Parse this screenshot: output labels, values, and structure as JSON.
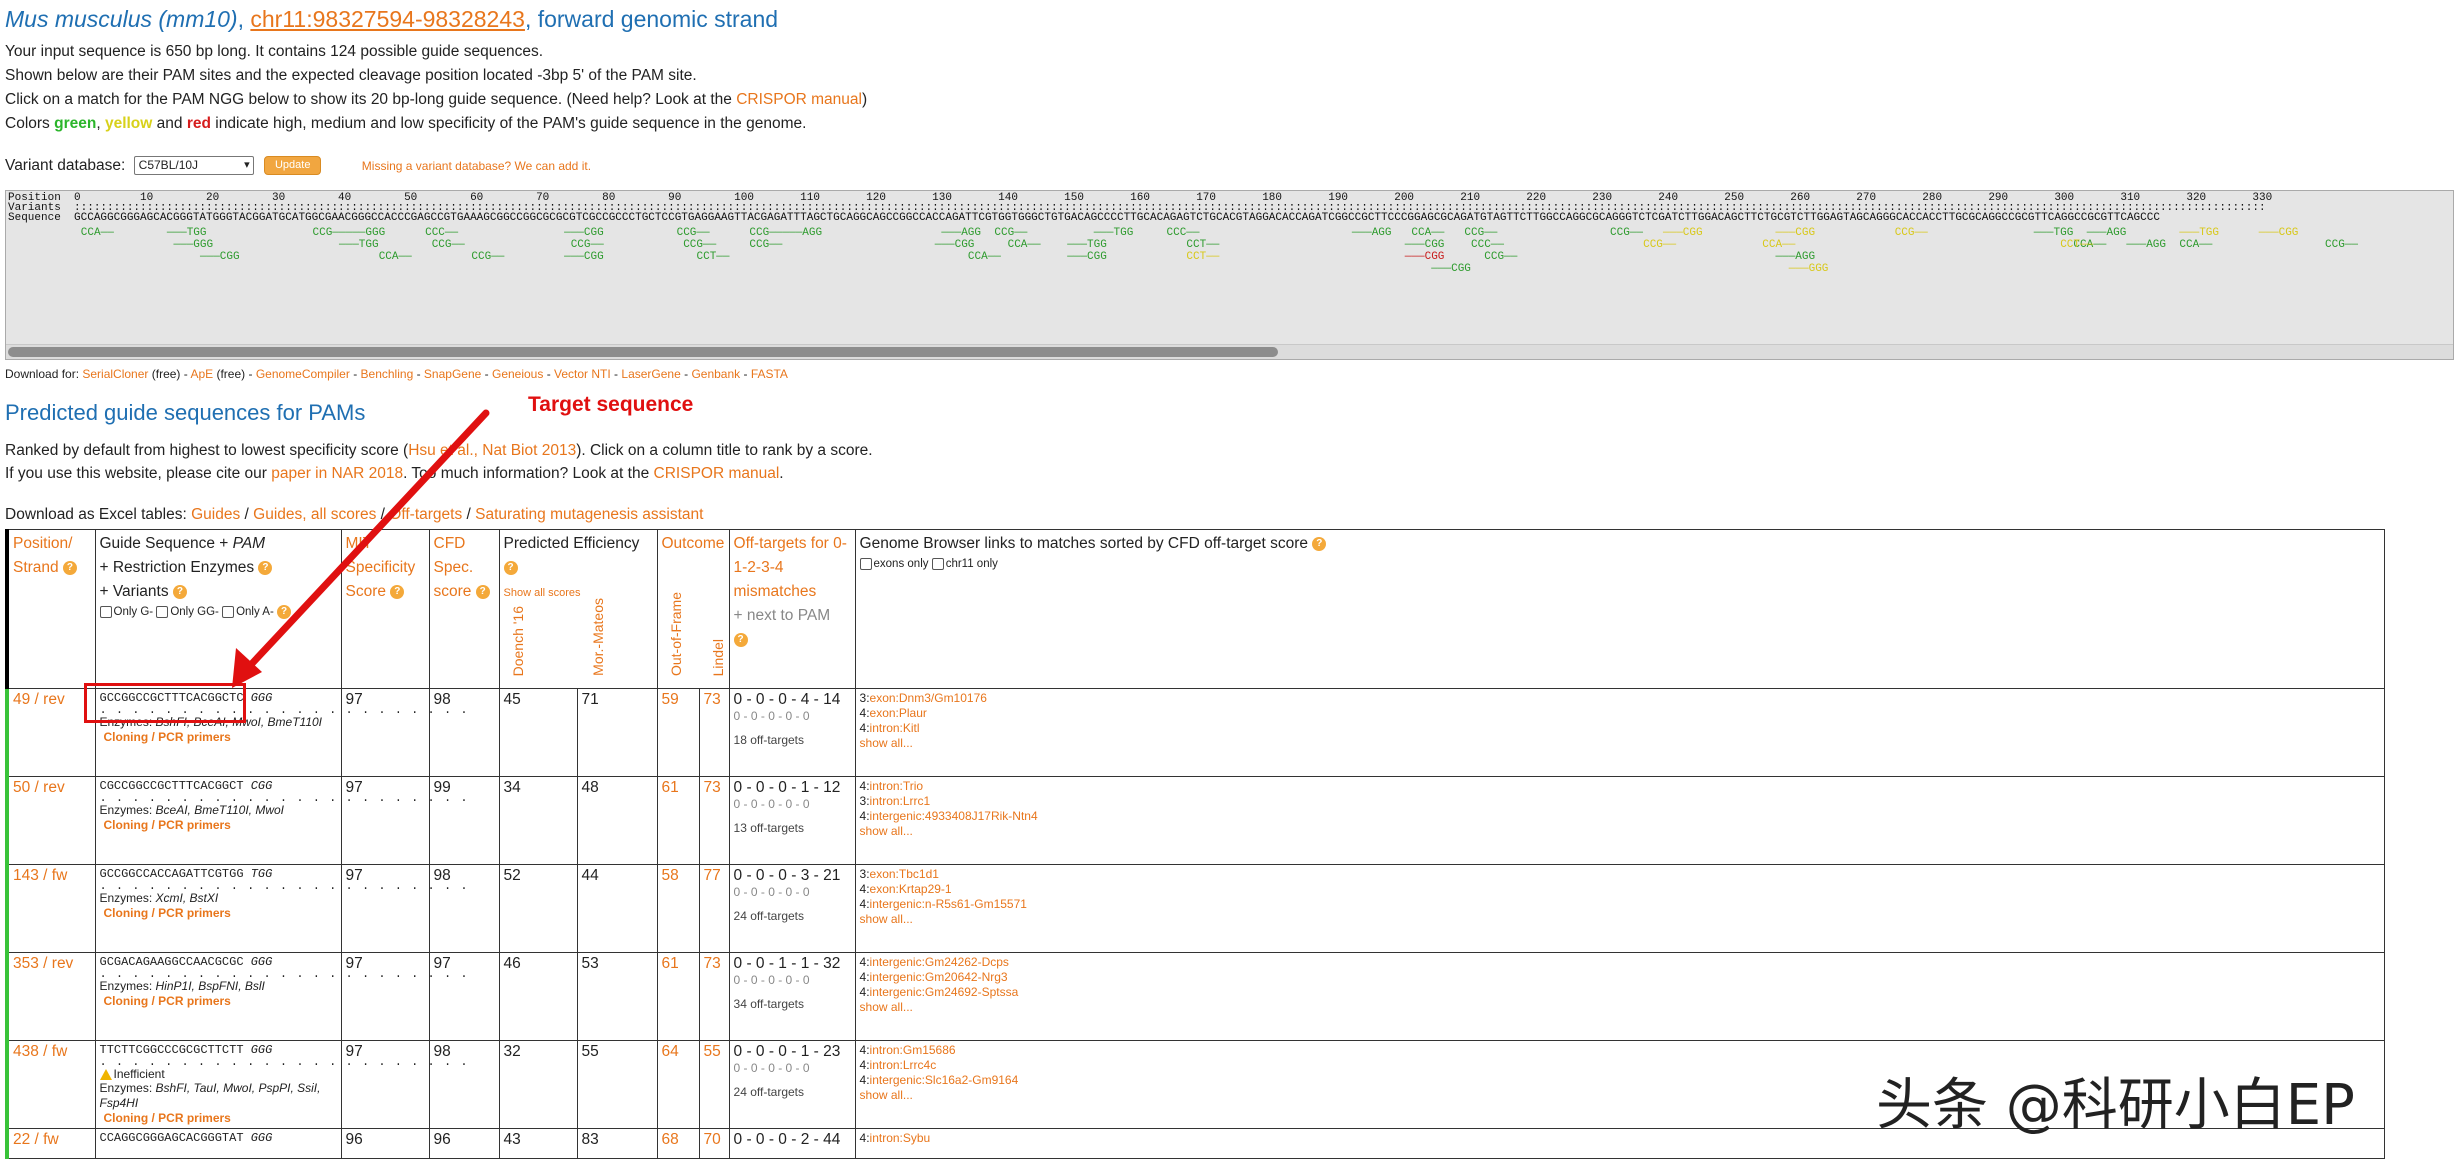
{
  "header": {
    "species": "Mus musculus (mm10)",
    "separator": ",",
    "coordinates": "chr11:98327594-98328243",
    "strand": ", forward genomic strand"
  },
  "intro": {
    "line1": "Your input sequence is 650 bp long. It contains 124 possible guide sequences.",
    "line2": "Shown below are their PAM sites and the expected cleavage position located -3bp 5' of the PAM site.",
    "line3_pre": "Click on a match for the PAM NGG below to show its 20 bp-long guide sequence. (Need help? Look at the ",
    "line3_link": "CRISPOR manual",
    "line3_post": ")",
    "line4_pre": "Colors ",
    "green": "green",
    "comma": ", ",
    "yellow": "yellow",
    "and": " and ",
    "red": "red",
    "line4_post": " indicate high, medium and low specificity of the PAM's guide sequence in the genome."
  },
  "variant": {
    "label": "Variant database:",
    "selected": "C57BL/10J",
    "update_label": "Update",
    "missing_link": "Missing a variant database? We can add it."
  },
  "sequence_view": {
    "ruler": "Position  0         10        20        30        40        50        60        70        80        90        100       110       120       130       140       150       160       170       180       190       200       210       220       230       240       250       260       270       280       290       300       310       320       330",
    "variants_label": "Variants  ::::::::::::::::::::::::::::::::::::::::::::::::::::::::::::::::::::::::::::::::::::::::::::::::::::::::::::::::::::::::::::::::::::::::::::::::::::::::::::::::::::::::::::::::::::::::::::::::::::::::::::::::::::::::::::::::::::::::::::::::::::::::::::::::::::::::::::::::::::::::::::::::::::::::::::::::::::::::::::::::::::::::::::",
    "sequence": "Sequence  GCCAGGCGGGAGCACGGGTATGGGTACGGATGCATGGCGAACGGGCCACCCGAGCCGTGAAAGCGGCCGGCGCGCGTCGCCGCCCTGCTCCGTGAGGAAGTTACGAGATTTAGCTGCAGGCAGCCGGCCACCAGATTCGTGGTGGGCTGTGACAGCCCCTTGCACAGAGTCTGCACGTAGGACACCAGATCGGCCGCTTCCCGGAGCGCAGATGTAGTTCTTGGCCAGGCGCAGGGTCTCGATCTTGGACAGCTTCTGCGTCTTGGAGTAGCAGGGCACCACCTTGCGCAGGCCGCGTTCAGGCCGCGTTCAGCCC",
    "scrollbar": "horizontal-scrollbar"
  },
  "pam_marks": [
    {
      "label": "CCA——",
      "c": "#2e9b2e",
      "col": 1,
      "row": 0
    },
    {
      "label": "———TGG",
      "c": "#2e9b2e",
      "col": 14,
      "row": 0
    },
    {
      "label": "———GGG",
      "c": "#2e9b2e",
      "col": 15,
      "row": 1
    },
    {
      "label": "———CGG",
      "c": "#2e9b2e",
      "col": 19,
      "row": 2
    },
    {
      "label": "CCG——",
      "c": "#2e9b2e",
      "col": 36,
      "row": 0
    },
    {
      "label": "———GGG",
      "c": "#2e9b2e",
      "col": 41,
      "row": 0
    },
    {
      "label": "———TGG",
      "c": "#2e9b2e",
      "col": 40,
      "row": 1
    },
    {
      "label": "CCA——",
      "c": "#2e9b2e",
      "col": 46,
      "row": 2
    },
    {
      "label": "CCC——",
      "c": "#2e9b2e",
      "col": 53,
      "row": 0
    },
    {
      "label": "CCG——",
      "c": "#2e9b2e",
      "col": 54,
      "row": 1
    },
    {
      "label": "CCG——",
      "c": "#2e9b2e",
      "col": 60,
      "row": 2
    },
    {
      "label": "———CGG",
      "c": "#2e9b2e",
      "col": 74,
      "row": 0
    },
    {
      "label": "CCG——",
      "c": "#2e9b2e",
      "col": 75,
      "row": 1
    },
    {
      "label": "———CGG",
      "c": "#2e9b2e",
      "col": 74,
      "row": 2
    },
    {
      "label": "CCG——",
      "c": "#2e9b2e",
      "col": 91,
      "row": 0
    },
    {
      "label": "CCG——",
      "c": "#2e9b2e",
      "col": 92,
      "row": 1
    },
    {
      "label": "CCT——",
      "c": "#2e9b2e",
      "col": 94,
      "row": 2
    },
    {
      "label": "CCG——",
      "c": "#2e9b2e",
      "col": 102,
      "row": 0
    },
    {
      "label": "———AGG",
      "c": "#2e9b2e",
      "col": 107,
      "row": 0
    },
    {
      "label": "CCG——",
      "c": "#2e9b2e",
      "col": 102,
      "row": 1
    },
    {
      "label": "———AGG",
      "c": "#2e9b2e",
      "col": 131,
      "row": 0
    },
    {
      "label": "———CGG",
      "c": "#2e9b2e",
      "col": 130,
      "row": 1
    },
    {
      "label": "CCA——",
      "c": "#2e9b2e",
      "col": 135,
      "row": 2
    },
    {
      "label": "CCG——",
      "c": "#2e9b2e",
      "col": 139,
      "row": 0
    },
    {
      "label": "CCA——",
      "c": "#2e9b2e",
      "col": 141,
      "row": 1
    },
    {
      "label": "———TGG",
      "c": "#2e9b2e",
      "col": 154,
      "row": 0
    },
    {
      "label": "———TGG",
      "c": "#2e9b2e",
      "col": 150,
      "row": 1
    },
    {
      "label": "———CGG",
      "c": "#2e9b2e",
      "col": 150,
      "row": 2
    },
    {
      "label": "CCC——",
      "c": "#2e9b2e",
      "col": 165,
      "row": 0
    },
    {
      "label": "CCT——",
      "c": "#2e9b2e",
      "col": 168,
      "row": 1
    },
    {
      "label": "CCT——",
      "c": "#d8c81a",
      "col": 168,
      "row": 2
    },
    {
      "label": "———AGG",
      "c": "#2e9b2e",
      "col": 193,
      "row": 0
    },
    {
      "label": "CCA——",
      "c": "#2e9b2e",
      "col": 202,
      "row": 0
    },
    {
      "label": "———CGG",
      "c": "#2e9b2e",
      "col": 201,
      "row": 1
    },
    {
      "label": "———CGG",
      "c": "#c81c1c",
      "col": 201,
      "row": 2
    },
    {
      "label": "———CGG",
      "c": "#2e9b2e",
      "col": 205,
      "row": 3
    },
    {
      "label": "CCG——",
      "c": "#2e9b2e",
      "col": 210,
      "row": 0
    },
    {
      "label": "CCC——",
      "c": "#2e9b2e",
      "col": 211,
      "row": 1
    },
    {
      "label": "CCG——",
      "c": "#2e9b2e",
      "col": 213,
      "row": 2
    },
    {
      "label": "CCG——",
      "c": "#2e9b2e",
      "col": 232,
      "row": 0
    },
    {
      "label": "CCG——",
      "c": "#d8c81a",
      "col": 237,
      "row": 1
    },
    {
      "label": "———CGG",
      "c": "#d8c81a",
      "col": 240,
      "row": 0
    },
    {
      "label": "———CGG",
      "c": "#d8c81a",
      "col": 257,
      "row": 0
    },
    {
      "label": "CCA——",
      "c": "#d8c81a",
      "col": 255,
      "row": 1
    },
    {
      "label": "———AGG",
      "c": "#2e9b2e",
      "col": 257,
      "row": 2
    },
    {
      "label": "———GGG",
      "c": "#d8c81a",
      "col": 259,
      "row": 3
    },
    {
      "label": "CCG——",
      "c": "#d8c81a",
      "col": 275,
      "row": 0
    },
    {
      "label": "———TGG",
      "c": "#2e9b2e",
      "col": 296,
      "row": 0
    },
    {
      "label": "———AGG",
      "c": "#2e9b2e",
      "col": 304,
      "row": 0
    },
    {
      "label": "CCA——",
      "c": "#2e9b2e",
      "col": 302,
      "row": 1
    },
    {
      "label": "———AGG",
      "c": "#2e9b2e",
      "col": 310,
      "row": 1
    },
    {
      "label": "CCT——",
      "c": "#d8c81a",
      "col": 300,
      "row": 1
    },
    {
      "label": "———TGG",
      "c": "#d8c81a",
      "col": 318,
      "row": 0
    },
    {
      "label": "———CGG",
      "c": "#d8c81a",
      "col": 330,
      "row": 0
    },
    {
      "label": "CCG——",
      "c": "#2e9b2e",
      "col": 340,
      "row": 1
    },
    {
      "label": "CCA——",
      "c": "#2e9b2e",
      "col": 318,
      "row": 1
    }
  ],
  "download_for": {
    "prefix": "Download for: ",
    "items": [
      {
        "name": "SerialCloner",
        "suffix": " (free)"
      },
      {
        "name": "ApE",
        "suffix": " (free)"
      },
      {
        "name": "GenomeCompiler",
        "suffix": ""
      },
      {
        "name": "Benchling",
        "suffix": ""
      },
      {
        "name": "SnapGene",
        "suffix": ""
      },
      {
        "name": "Geneious",
        "suffix": ""
      },
      {
        "name": "Vector NTI",
        "suffix": ""
      },
      {
        "name": "LaserGene",
        "suffix": ""
      },
      {
        "name": "Genbank",
        "suffix": ""
      },
      {
        "name": "FASTA",
        "suffix": ""
      }
    ],
    "sep": " - "
  },
  "predicted": {
    "title": "Predicted guide sequences for PAMs",
    "rank_pre": "Ranked by default from highest to lowest specificity score (",
    "rank_link": "Hsu et al., Nat Biot 2013",
    "rank_post": "). Click on a column title to rank by a score.",
    "cite_pre": "If you use this website, please cite our ",
    "cite_link": "paper in NAR 2018",
    "cite_mid": ". Too much information? Look at the ",
    "cite_link2": "CRISPOR manual",
    "cite_post": ".",
    "excel_pre": "Download as Excel tables: ",
    "excel_links": [
      "Guides",
      "Guides, all scores",
      "Off-targets",
      "Saturating mutagenesis assistant"
    ],
    "excel_sep": " / "
  },
  "table": {
    "h_pos": "Position/ Strand",
    "h_guide_1": "Guide Sequence + ",
    "h_guide_pam": "PAM",
    "h_guide_2": "+ Restriction Enzymes",
    "h_guide_3": "+ Variants",
    "f_only_g": "Only G-",
    "f_only_gg": "Only GG-",
    "f_only_a": "Only A-",
    "h_mit": "MIT Specificity Score",
    "h_cfd": "CFD Spec. score",
    "h_eff": "Predicted Efficiency",
    "h_eff_showall": "Show all scores",
    "h_doench": "Doench '16",
    "h_mor": "Mor.-Mateos",
    "h_outcome": "Outcome",
    "h_oof": "Out-of-Frame",
    "h_lindel": "Lindel",
    "h_off": "Off-targets for 0-1-2-3-4 mismatches",
    "h_off_pam": "+ next to PAM",
    "h_gb": "Genome Browser links to matches sorted by CFD off-target score",
    "gb_exons": "exons only",
    "gb_chr": "chr11 only",
    "cloning_label": "Cloning / PCR primers",
    "enz_prefix": "Enzymes: ",
    "show_all": "show all...",
    "rows": [
      {
        "pos": "49 / rev",
        "seq": "GCCGGCCGCTTTCACGGCTC",
        "pam": "GGG",
        "dots": ". . . . . . . . . . . . . . . . . . . .  . . .",
        "inefficient": "",
        "enz": "BshFI, BceAI, MwoI, BmeT110I",
        "mit": "97",
        "cfd": "98",
        "doench": "45",
        "mor": "71",
        "oof": "59",
        "lindel": "73",
        "off": "0 - 0 - 0 - 4 - 14",
        "off_sub": "0 - 0 - 0 - 0 - 0",
        "off_count": "18 off-targets",
        "gb": [
          {
            "n": "3",
            "t": "exon:Dnm3/Gm10176"
          },
          {
            "n": "4",
            "t": "exon:Plaur"
          },
          {
            "n": "4",
            "t": "intron:Kitl"
          }
        ]
      },
      {
        "pos": "50 / rev",
        "seq": "CGCCGGCCGCTTTCACGGCT",
        "pam": "CGG",
        "dots": ". . . . . . . . . . . . . . . . . . . .  . . .",
        "inefficient": "",
        "enz": "BceAI, BmeT110I, MwoI",
        "mit": "97",
        "cfd": "99",
        "doench": "34",
        "mor": "48",
        "oof": "61",
        "lindel": "73",
        "off": "0 - 0 - 0 - 1 - 12",
        "off_sub": "0 - 0 - 0 - 0 - 0",
        "off_count": "13 off-targets",
        "gb": [
          {
            "n": "4",
            "t": "intron:Trio"
          },
          {
            "n": "3",
            "t": "intron:Lrrc1"
          },
          {
            "n": "4",
            "t": "intergenic:4933408J17Rik-Ntn4"
          }
        ]
      },
      {
        "pos": "143 / fw",
        "seq": "GCCGGCCACCAGATTCGTGG",
        "pam": "TGG",
        "dots": ". . . . . . . . . . . . . . . . . . . .  . . .",
        "inefficient": "",
        "enz": "XcmI, BstXI",
        "mit": "97",
        "cfd": "98",
        "doench": "52",
        "mor": "44",
        "oof": "58",
        "lindel": "77",
        "off": "0 - 0 - 0 - 3 - 21",
        "off_sub": "0 - 0 - 0 - 0 - 0",
        "off_count": "24 off-targets",
        "gb": [
          {
            "n": "3",
            "t": "exon:Tbc1d1"
          },
          {
            "n": "4",
            "t": "exon:Krtap29-1"
          },
          {
            "n": "4",
            "t": "intergenic:n-R5s61-Gm15571"
          }
        ]
      },
      {
        "pos": "353 / rev",
        "seq": "GCGACAGAAGGCCAACGCGC",
        "pam": "GGG",
        "dots": ". . . . . . . . . . . . . . . . . . . .  . . .",
        "inefficient": "",
        "enz": "HinP1I, BspFNI, BslI",
        "mit": "97",
        "cfd": "97",
        "doench": "46",
        "mor": "53",
        "oof": "61",
        "lindel": "73",
        "off": "0 - 0 - 1 - 1 - 32",
        "off_sub": "0 - 0 - 0 - 0 - 0",
        "off_count": "34 off-targets",
        "gb": [
          {
            "n": "4",
            "t": "intergenic:Gm24262-Dcps"
          },
          {
            "n": "4",
            "t": "intergenic:Gm20642-Nrg3"
          },
          {
            "n": "4",
            "t": "intergenic:Gm24692-Sptssa"
          }
        ]
      },
      {
        "pos": "438 / fw",
        "seq": "TTCTTCGGCCCGCGCTTCTT",
        "pam": "GGG",
        "dots": ". . . . . . . . . . . . . . . . . . . .  . . .",
        "inefficient": "Inefficient",
        "enz": "BshFI, TauI, MwoI, PspPI, SsiI, Fsp4HI",
        "mit": "97",
        "cfd": "98",
        "doench": "32",
        "mor": "55",
        "oof": "64",
        "lindel": "55",
        "off": "0 - 0 - 0 - 1 - 23",
        "off_sub": "0 - 0 - 0 - 0 - 0",
        "off_count": "24 off-targets",
        "gb": [
          {
            "n": "4",
            "t": "intron:Gm15686"
          },
          {
            "n": "4",
            "t": "intron:Lrrc4c"
          },
          {
            "n": "4",
            "t": "intergenic:Slc16a2-Gm9164"
          }
        ]
      },
      {
        "pos": "22 / fw",
        "seq": "CCAGGCGGGAGCACGGGTAT",
        "pam": "GGG",
        "dots": "",
        "inefficient": "",
        "enz": "",
        "mit": "96",
        "cfd": "96",
        "doench": "43",
        "mor": "83",
        "oof": "68",
        "lindel": "70",
        "off": "0 - 0 - 0 - 2 - 44",
        "off_sub": "",
        "off_count": "",
        "gb": [
          {
            "n": "4",
            "t": "intron:Sybu"
          }
        ]
      }
    ]
  },
  "annotation": {
    "label": "Target sequence",
    "arrow_color": "#e01010"
  },
  "watermark": "头条 @科研小白EP"
}
